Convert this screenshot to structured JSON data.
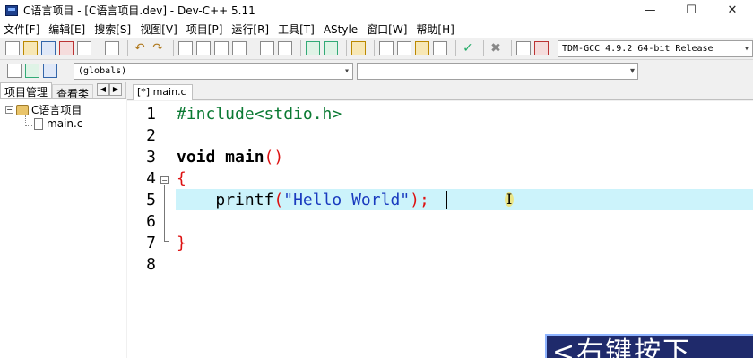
{
  "window": {
    "title": "C语言项目 - [C语言项目.dev] - Dev-C++ 5.11",
    "controls": {
      "minimize": "—",
      "maximize": "☐",
      "close": "✕"
    }
  },
  "menu": {
    "items": [
      "文件[F]",
      "编辑[E]",
      "搜索[S]",
      "视图[V]",
      "项目[P]",
      "运行[R]",
      "工具[T]",
      "AStyle",
      "窗口[W]",
      "帮助[H]"
    ]
  },
  "toolbar": {
    "compiler": "TDM-GCC 4.9.2 64-bit Release",
    "scope": "(globals)",
    "member": ""
  },
  "left_panel": {
    "tabs": [
      "项目管理",
      "查看类"
    ],
    "tree": {
      "project": "C语言项目",
      "file": "main.c"
    }
  },
  "editor": {
    "tab_label": "[*] main.c",
    "line_numbers": [
      "1",
      "2",
      "3",
      "4",
      "5",
      "6",
      "7",
      "8"
    ],
    "code": {
      "l1": "#include<stdio.h>",
      "l3_kw": "void main",
      "l3_paren": "()",
      "l4": "{",
      "l5_indent": "    ",
      "l5_fn": "printf",
      "l5_open": "(",
      "l5_str": "\"Hello World\"",
      "l5_close": ");",
      "l7": "}"
    }
  },
  "overlay": {
    "text": "<右键按下"
  }
}
